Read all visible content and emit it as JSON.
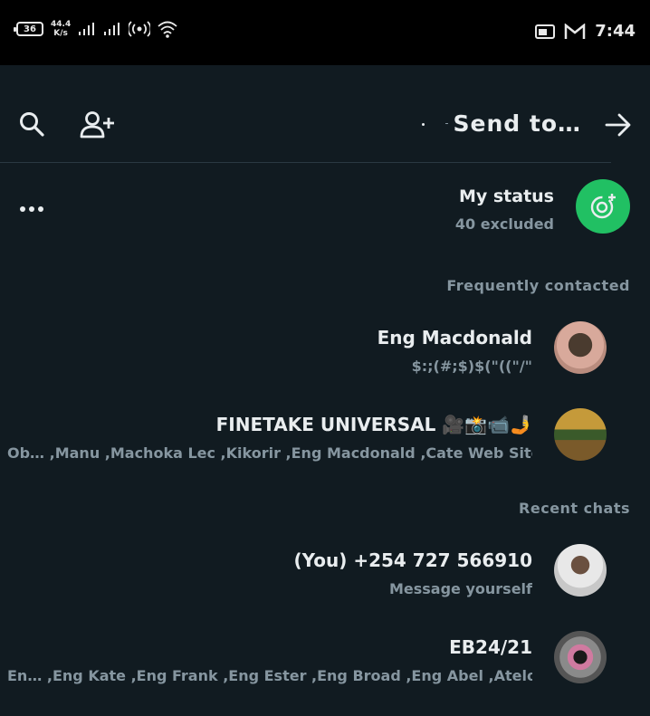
{
  "statusbar": {
    "battery": "36",
    "net_speed_value": "44.4",
    "net_speed_unit": "K/s",
    "time": "7:44",
    "icons": [
      "battery-icon",
      "signal-icon",
      "signal-icon",
      "hotspot-icon",
      "wifi-icon",
      "cast-icon",
      "gmail-icon"
    ]
  },
  "topbar": {
    "title": "Send to…",
    "icons": [
      "search-icon",
      "add-contact-icon",
      "arrow-right-icon"
    ]
  },
  "my_status": {
    "label": "My status",
    "subtitle": "40 excluded"
  },
  "sections": {
    "frequent": "Frequently contacted",
    "recent": "Recent chats"
  },
  "frequent_chats": [
    {
      "name": "Eng Macdonald",
      "subtitle": "$:;(#;$)$(\"((\"/\""
    },
    {
      "name": "FINETAKE UNIVERSAL 🎥📸📹🤳",
      "subtitle": "Ob… ,Manu ,Machoka Lec ,Kikorir ,Eng Macdonald ,Cate  Web Site"
    }
  ],
  "recent_chats": [
    {
      "name": "(You) +254 727 566910",
      "subtitle": "Message yourself"
    },
    {
      "name": "EB24/21",
      "subtitle": "En… ,Eng Kate ,Eng Frank  ,Eng Ester ,Eng Broad ,Eng Abel ,Atelo"
    }
  ],
  "colors": {
    "background": "#111b21",
    "statusbar": "#000000",
    "accent": "#21c063",
    "secondary_text": "#8696a0"
  }
}
